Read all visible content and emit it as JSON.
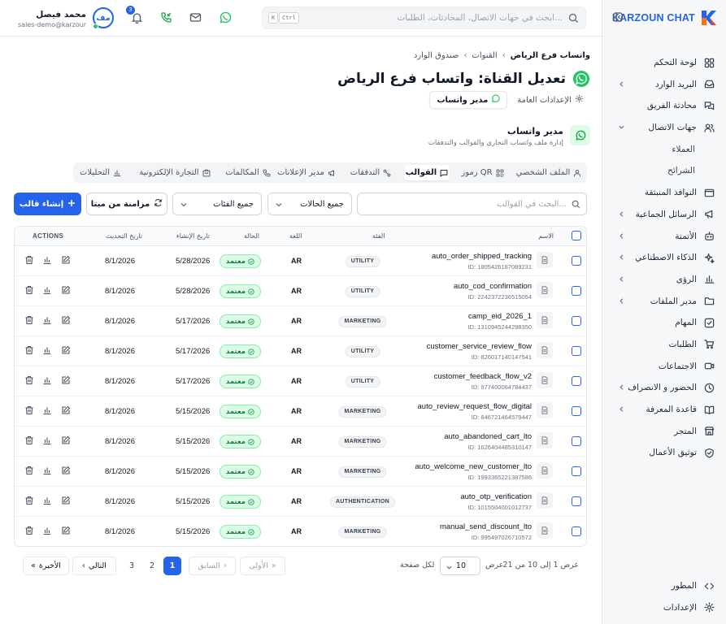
{
  "brand": {
    "name": "KARZOUN CHAT"
  },
  "sidebar": {
    "items": [
      {
        "label": "لوحة التحكم",
        "icon": "dashboard-icon",
        "chevron": false
      },
      {
        "label": "البريد الوارد",
        "icon": "inbox-icon",
        "chevron": true
      },
      {
        "label": "محادثة الفريق",
        "icon": "team-chat-icon",
        "chevron": false
      },
      {
        "label": "جهات الاتصال",
        "icon": "users-icon",
        "chevron": true,
        "expanded": true
      },
      {
        "label": "العملاء",
        "sub": true
      },
      {
        "label": "الشرائح",
        "sub": true
      },
      {
        "label": "النوافذ المنبثقة",
        "icon": "popup-icon",
        "chevron": false
      },
      {
        "label": "الرسائل الجماعية",
        "icon": "megaphone-icon",
        "chevron": true
      },
      {
        "label": "الأتمتة",
        "icon": "bot-icon",
        "chevron": true
      },
      {
        "label": "الذكاء الاصطناعي",
        "icon": "sparkles-icon",
        "chevron": true
      },
      {
        "label": "الرؤى",
        "icon": "bar-chart-icon",
        "chevron": true
      },
      {
        "label": "مدير الملفات",
        "icon": "folder-icon",
        "chevron": true
      },
      {
        "label": "المهام",
        "icon": "checkbox-icon",
        "chevron": false
      },
      {
        "label": "الطلبات",
        "icon": "cart-icon",
        "chevron": false
      },
      {
        "label": "الاجتماعات",
        "icon": "video-icon",
        "chevron": false
      },
      {
        "label": "الحضور و الانصراف",
        "icon": "clock-icon",
        "chevron": true
      },
      {
        "label": "قاعدة المعرفة",
        "icon": "book-icon",
        "chevron": true
      },
      {
        "label": "المتجر",
        "icon": "store-icon",
        "chevron": false
      },
      {
        "label": "توثيق الأعمال",
        "icon": "shield-check-icon",
        "chevron": false
      }
    ],
    "bottom": [
      {
        "label": "المطور",
        "icon": "code-icon"
      },
      {
        "label": "الإعدادات",
        "icon": "gear-icon"
      }
    ]
  },
  "topbar": {
    "search_placeholder": "ابحث في جهات الاتصال، المحادثات، الطلبات...",
    "kbd_ctrl": "Ctrl",
    "kbd_k": "K",
    "notif_count": "3",
    "user": {
      "name": "محمد فيصل",
      "email": "sales-demo@karzoun...",
      "initials": "مف"
    }
  },
  "breadcrumb": {
    "items": [
      "صندوق الوارد",
      "القنوات",
      "واتساب فرع الرياض"
    ]
  },
  "header": {
    "title": "تعديل القناة: واتساب فرع الرياض",
    "tabs": [
      {
        "label": "الإعدادات العامة",
        "icon": "gear-icon",
        "active": false
      },
      {
        "label": "مدير واتساب",
        "icon": "whatsapp-icon",
        "active": true
      }
    ]
  },
  "manager": {
    "title": "مدير واتساب",
    "description": "إدارة ملف واتساب التجاري والقوالب والتدفقات"
  },
  "subtabs": [
    {
      "label": "الملف الشخصي",
      "icon": "user-icon",
      "active": false
    },
    {
      "label": "رموز QR",
      "icon": "qr-icon",
      "active": false
    },
    {
      "label": "القوالب",
      "icon": "message-icon",
      "active": true
    },
    {
      "label": "التدفقات",
      "icon": "flow-icon",
      "active": false
    },
    {
      "label": "مدير الإعلانات",
      "icon": "megaphone-icon",
      "active": false
    },
    {
      "label": "المكالمات",
      "icon": "phone-icon",
      "active": false
    },
    {
      "label": "التجارة الإلكترونية",
      "icon": "shop-icon",
      "active": false
    },
    {
      "label": "التحليلات",
      "icon": "bar-chart-icon",
      "active": false
    }
  ],
  "filters": {
    "search_placeholder": "البحث في القوالب...",
    "status_select": "جميع الحالات",
    "category_select": "جميع الفئات",
    "sync_label": "مزامنة من ميتا",
    "create_label": "إنشاء قالب"
  },
  "table": {
    "headers": {
      "name": "الاسم",
      "category": "الفئة",
      "language": "اللغة",
      "status": "الحالة",
      "created": "تاريخ الإنشاء",
      "updated": "تاريخ التحديث",
      "actions": "ACTIONS"
    },
    "rows": [
      {
        "name": "auto_order_shipped_tracking",
        "id": "ID: 1805426187089231",
        "category": "UTILITY",
        "language": "AR",
        "status": "معتمد",
        "created": "5/28/2026",
        "updated": "8/1/2026"
      },
      {
        "name": "auto_cod_confirmation",
        "id": "ID: 2242372236515054",
        "category": "UTILITY",
        "language": "AR",
        "status": "معتمد",
        "created": "5/28/2026",
        "updated": "8/1/2026"
      },
      {
        "name": "camp_eid_2026_1",
        "id": "ID: 1310945244298350",
        "category": "MARKETING",
        "language": "AR",
        "status": "معتمد",
        "created": "5/17/2026",
        "updated": "8/1/2026"
      },
      {
        "name": "customer_service_review_flow",
        "id": "ID: 826017140147541",
        "category": "UTILITY",
        "language": "AR",
        "status": "معتمد",
        "created": "5/17/2026",
        "updated": "8/1/2026"
      },
      {
        "name": "customer_feedback_flow_v2",
        "id": "ID: 977400064784437",
        "category": "UTILITY",
        "language": "AR",
        "status": "معتمد",
        "created": "5/17/2026",
        "updated": "8/1/2026"
      },
      {
        "name": "auto_review_request_flow_digital",
        "id": "ID: 846721464579447",
        "category": "MARKETING",
        "language": "AR",
        "status": "معتمد",
        "created": "5/15/2026",
        "updated": "8/1/2026"
      },
      {
        "name": "auto_abandoned_cart_lto",
        "id": "ID: 1626404485310147",
        "category": "MARKETING",
        "language": "AR",
        "status": "معتمد",
        "created": "5/15/2026",
        "updated": "8/1/2026"
      },
      {
        "name": "auto_welcome_new_customer_lto",
        "id": "ID: 1993365221387586",
        "category": "MARKETING",
        "language": "AR",
        "status": "معتمد",
        "created": "5/15/2026",
        "updated": "8/1/2026"
      },
      {
        "name": "auto_otp_verification",
        "id": "ID: 1015504001012737",
        "category": "AUTHENTICATION",
        "language": "AR",
        "status": "معتمد",
        "created": "5/15/2026",
        "updated": "8/1/2026"
      },
      {
        "name": "manual_send_discount_lto",
        "id": "ID: 995497026710572",
        "category": "MARKETING",
        "language": "AR",
        "status": "معتمد",
        "created": "5/15/2026",
        "updated": "8/1/2026"
      }
    ]
  },
  "pagination": {
    "info": "عرض 1 إلى 10 من 21",
    "show_label": "عرض",
    "per_page_value": "10",
    "per_page_label": "لكل صفحة",
    "first_label": "الأولى",
    "prev_label": "السابق",
    "pages": [
      "1",
      "2",
      "3"
    ],
    "current_page": "1",
    "next_label": "التالي",
    "last_label": "الأخيرة"
  },
  "colors": {
    "primary": "#2563eb",
    "whatsapp": "#22c55e",
    "approved_bg": "#dcfce7",
    "approved_text": "#15803d"
  }
}
